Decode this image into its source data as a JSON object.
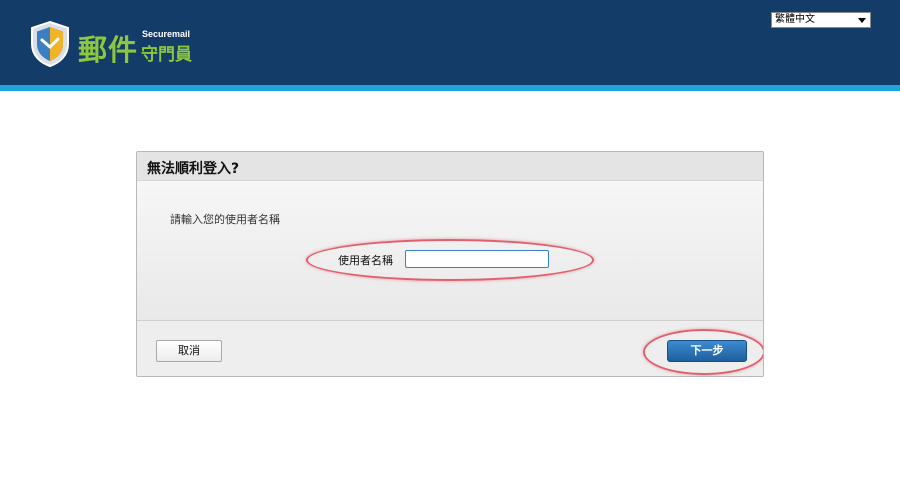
{
  "header": {
    "logo": {
      "name_main": "郵件",
      "name_en": "Securemail",
      "name_sub": "守門員"
    },
    "language_select": {
      "selected": "繁體中文"
    }
  },
  "dialog": {
    "title": "無法順利登入?",
    "instruction": "請輸入您的使用者名稱",
    "username": {
      "label": "使用者名稱",
      "value": ""
    },
    "cancel_label": "取消",
    "next_label": "下一步"
  },
  "colors": {
    "header_bg": "#143c68",
    "header_stripe": "#1fa3dc",
    "logo_green": "#8dc63f",
    "primary_button": "#2a6fb3",
    "annotation_red": "#e0606e"
  },
  "icons": {
    "logo": "shield-icon",
    "language_dropdown": "dropdown-arrow-icon"
  }
}
